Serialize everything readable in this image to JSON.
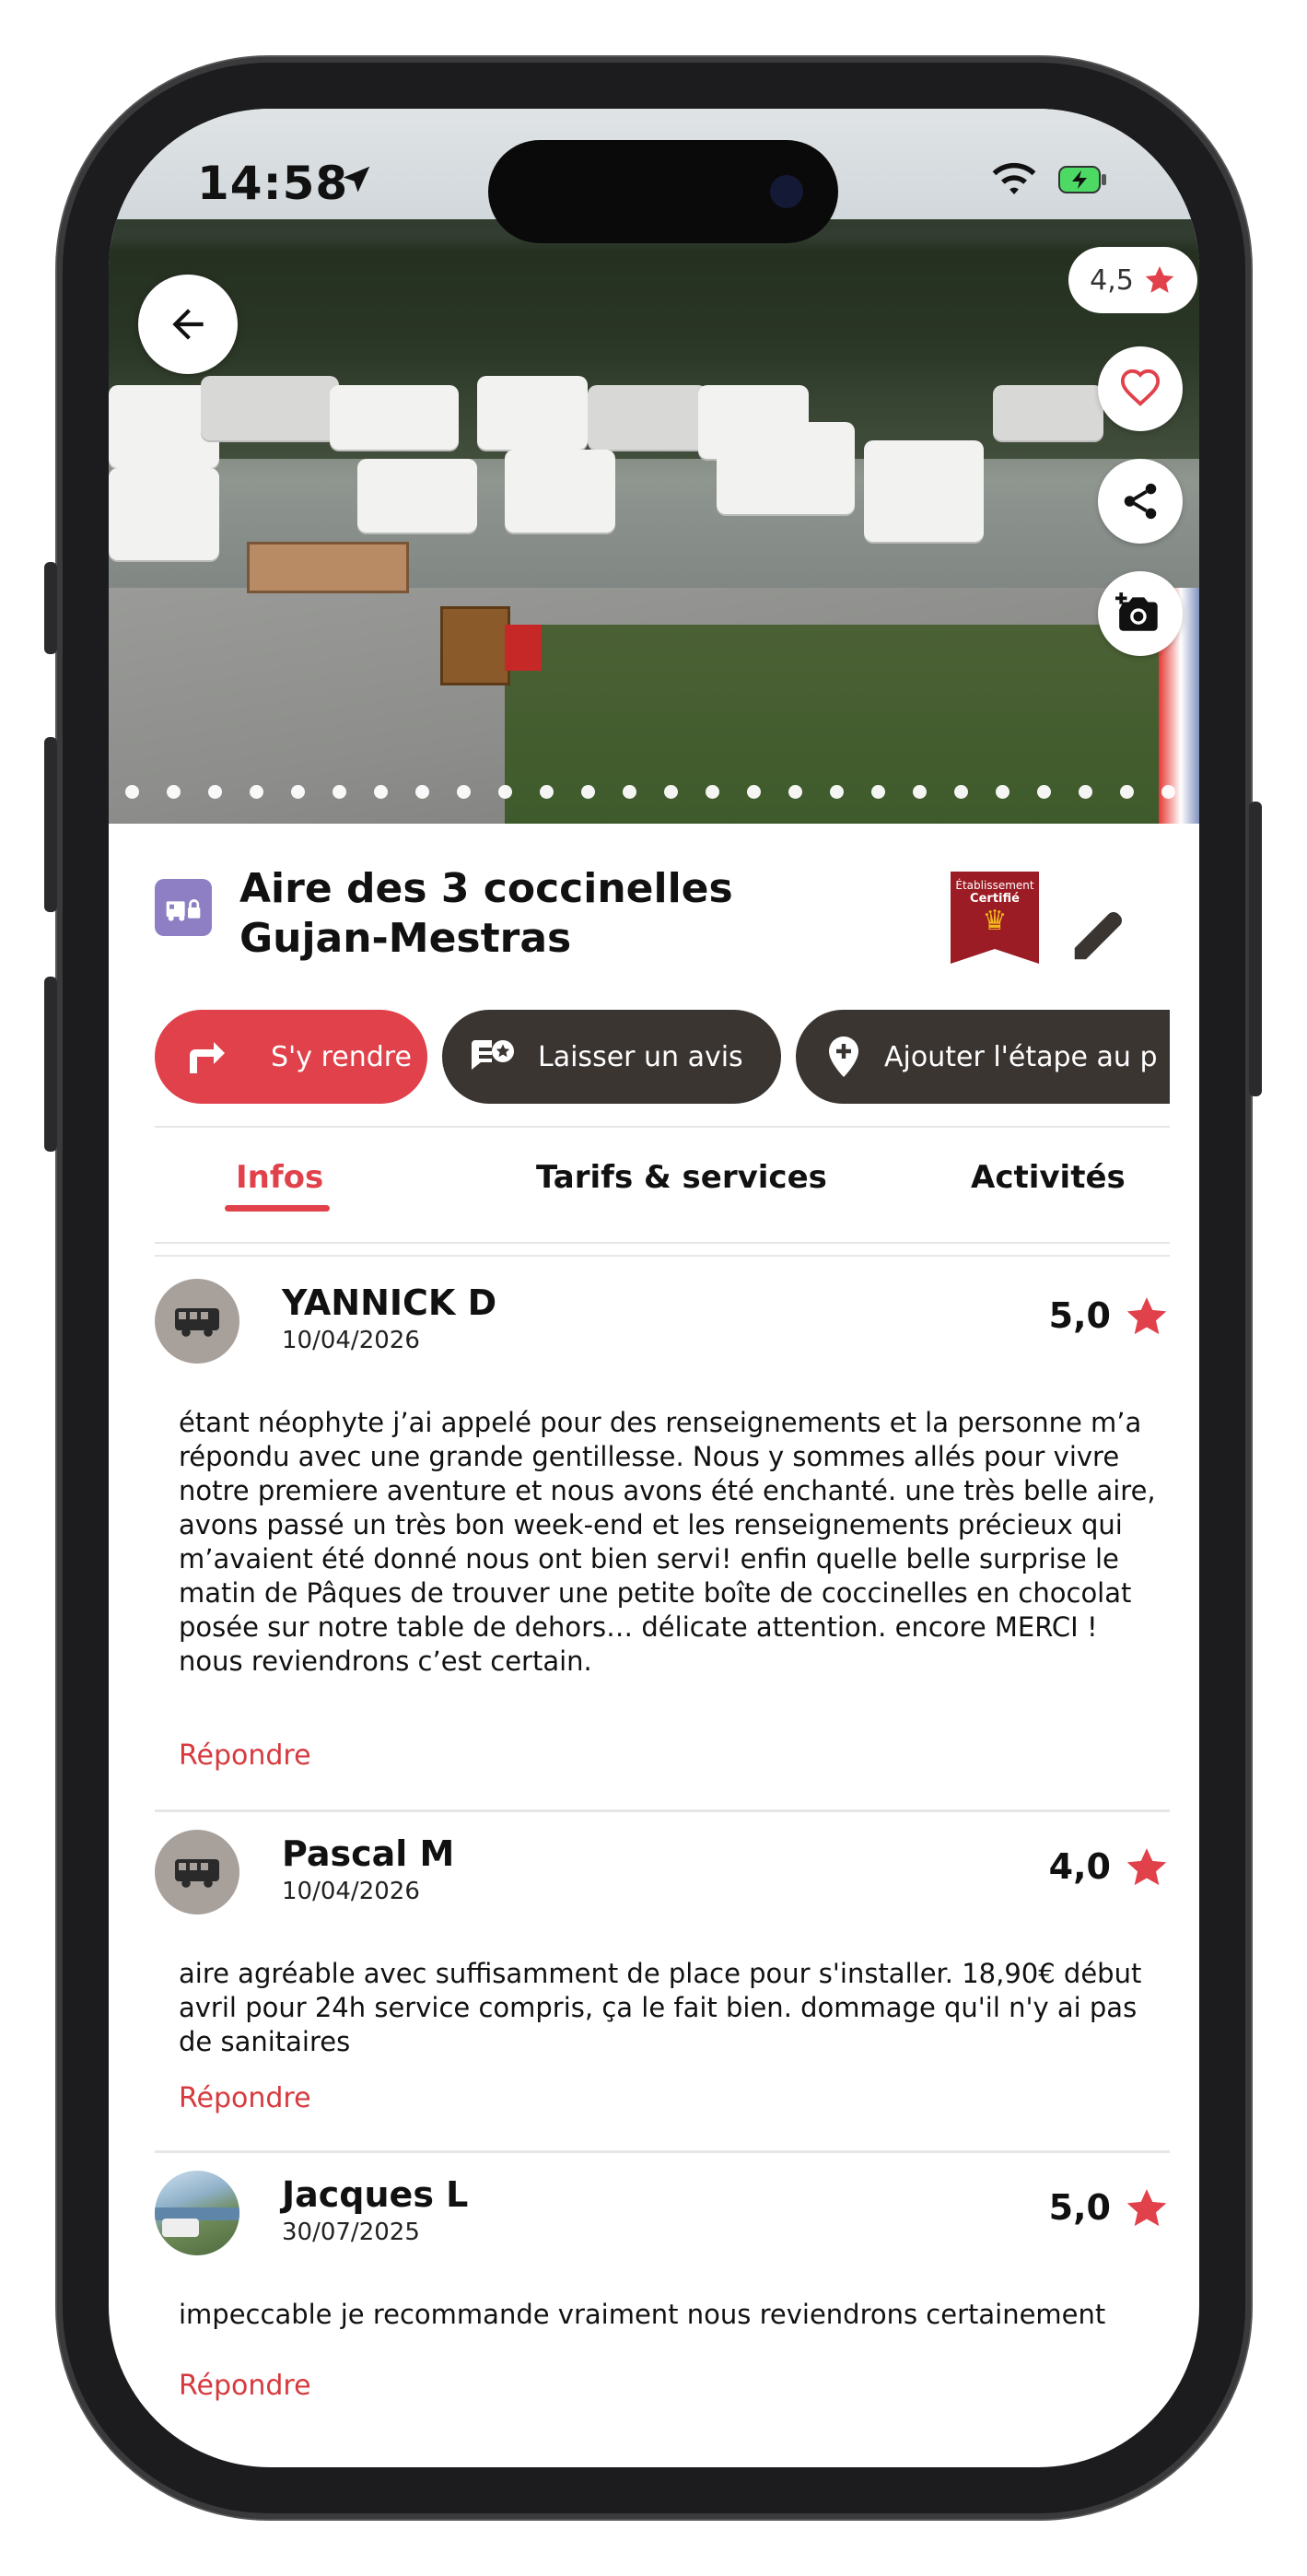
{
  "status_bar": {
    "time": "14:58"
  },
  "hero": {
    "rating": "4,5",
    "photo_count": 26,
    "icons": {
      "back": "arrow-left-icon",
      "favorite": "heart-icon",
      "share": "share-icon",
      "add_photo": "camera-plus-icon"
    }
  },
  "place": {
    "title": "Aire des 3 coccinelles Gujan-Mestras",
    "badge_line1": "Établissement",
    "badge_line2": "Certifié"
  },
  "actions": [
    {
      "label": "S'y rendre",
      "icon": "directions-icon"
    },
    {
      "label": "Laisser un avis",
      "icon": "review-icon"
    },
    {
      "label": "Ajouter l'étape au p",
      "icon": "add-location-icon"
    }
  ],
  "tabs": [
    "Infos",
    "Tarifs & services",
    "Activités"
  ],
  "reviews": [
    {
      "name": "YANNICK D",
      "date": "10/04/2026",
      "score": "5,0",
      "text": "étant néophyte j’ai appelé pour des renseignements et la personne m’a répondu avec une grande gentillesse. Nous y sommes allés pour vivre notre premiere aventure et nous avons été enchanté. une très belle aire, avons passé un très bon week-end et les renseignements précieux qui m’avaient été donné nous ont bien servi! enfin quelle belle surprise le matin de Pâques de trouver une petite boîte de coccinelles en chocolat posée sur notre table de dehors… délicate attention. encore MERCI ! nous reviendrons c’est certain.",
      "reply": "Répondre"
    },
    {
      "name": "Pascal  M",
      "date": "10/04/2026",
      "score": "4,0",
      "text": "aire agréable avec suffisamment de place pour s'installer. 18,90€ début avril pour 24h service compris, ça le  fait bien. dommage qu'il n'y ai pas de sanitaires",
      "reply": "Répondre"
    },
    {
      "name": "Jacques L",
      "date": "30/07/2025",
      "score": "5,0",
      "text": "impeccable je recommande vraiment  nous reviendrons certainement",
      "reply": "Répondre"
    }
  ],
  "colors": {
    "accent": "#e0414a",
    "dark_button": "#3b3532",
    "badge": "#9b1c24",
    "type_icon": "#8e7fc4"
  }
}
